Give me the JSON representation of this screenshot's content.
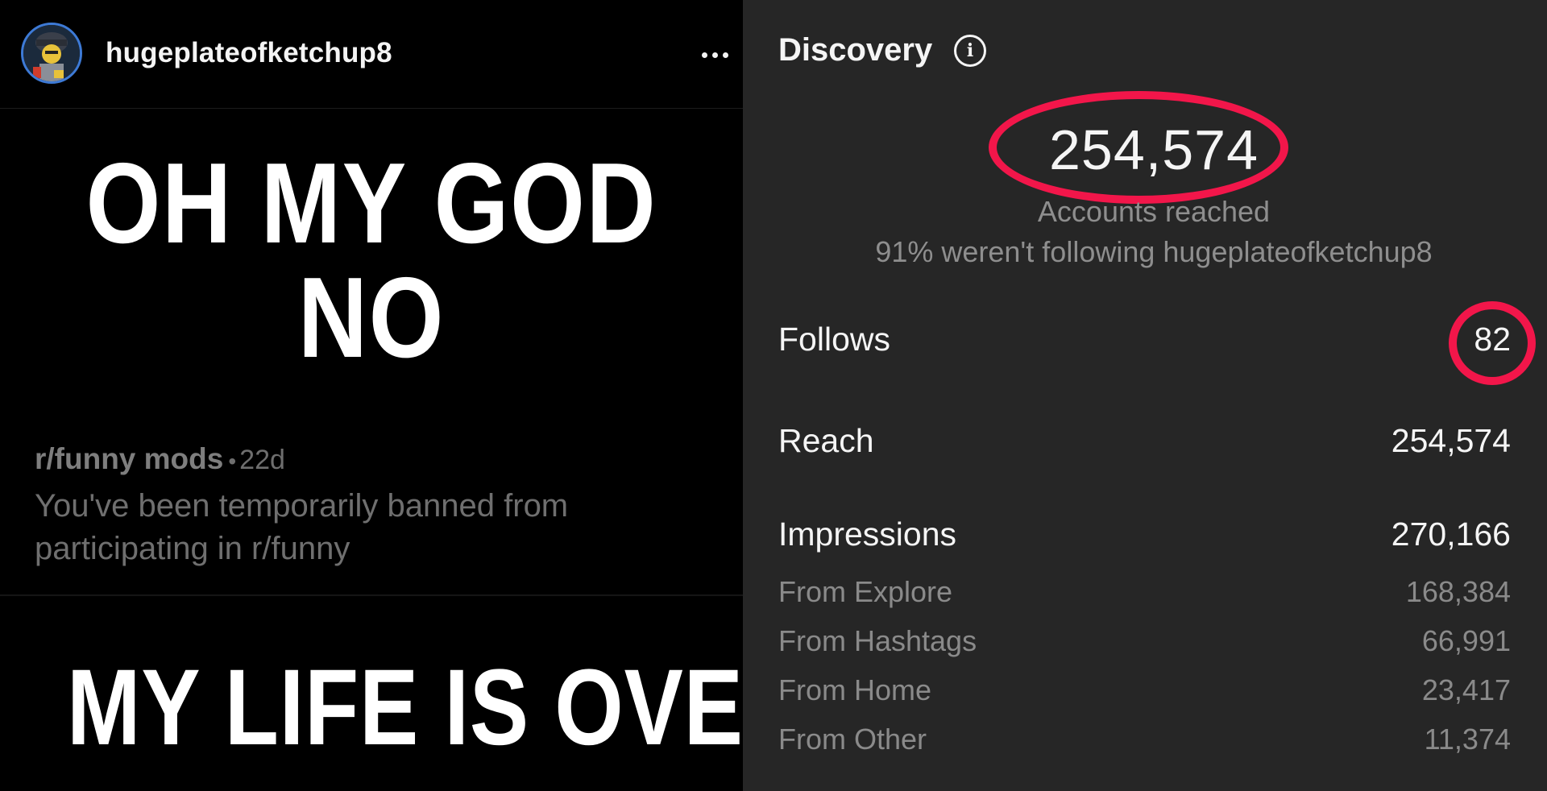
{
  "post": {
    "username": "hugeplateofketchup8",
    "avatar_icon": "lego-figure-avatar-icon",
    "more_icon": "more-options-icon",
    "meme_top_text": "OH MY GOD NO",
    "notification": {
      "title": "r/funny mods",
      "separator": "•",
      "time": "22d",
      "message_line1": "You've been temporarily banned from",
      "message_line2": "participating in r/funny"
    },
    "meme_bottom_text": "MY LIFE IS OVER."
  },
  "insights": {
    "section_title": "Discovery",
    "info_icon": "info-icon",
    "accounts_reached_value": "254,574",
    "accounts_reached_label": "Accounts reached",
    "non_followers_text": "91% weren't following hugeplateofketchup8",
    "highlight_color": "#f2164a",
    "metrics": [
      {
        "label": "Follows",
        "value": "82"
      },
      {
        "label": "Reach",
        "value": "254,574"
      },
      {
        "label": "Impressions",
        "value": "270,166"
      }
    ],
    "impression_sources": [
      {
        "label": "From Explore",
        "value": "168,384"
      },
      {
        "label": "From Hashtags",
        "value": "66,991"
      },
      {
        "label": "From Home",
        "value": "23,417"
      },
      {
        "label": "From Other",
        "value": "11,374"
      }
    ]
  }
}
